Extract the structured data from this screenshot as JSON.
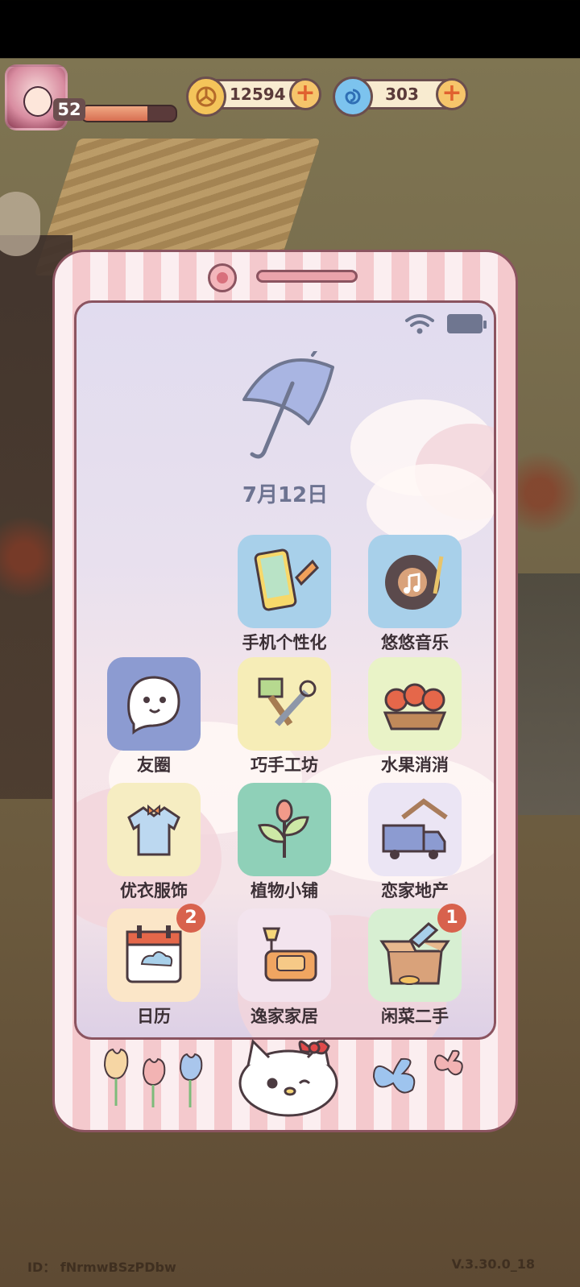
{
  "hud": {
    "level": "52",
    "xp_progress": 0.7,
    "gold": {
      "value": "12594",
      "icon": "gold-coin-icon"
    },
    "gems": {
      "value": "303",
      "icon": "swirl-gem-icon"
    }
  },
  "phone": {
    "status": {
      "wifi_icon": "wifi-icon",
      "battery_icon": "battery-icon"
    },
    "weather_icon": "umbrella-icon",
    "date": "7月12日",
    "apps": [
      {
        "label": "手机个性化",
        "icon": "phone-customize-icon",
        "badge": ""
      },
      {
        "label": "悠悠音乐",
        "icon": "music-record-icon",
        "badge": ""
      },
      {
        "label": "友圈",
        "icon": "ghost-chat-icon",
        "badge": ""
      },
      {
        "label": "巧手工坊",
        "icon": "tools-icon",
        "badge": ""
      },
      {
        "label": "水果消消",
        "icon": "fruit-basket-icon",
        "badge": ""
      },
      {
        "label": "优衣服饰",
        "icon": "shirt-icon",
        "badge": ""
      },
      {
        "label": "植物小铺",
        "icon": "plant-icon",
        "badge": ""
      },
      {
        "label": "恋家地产",
        "icon": "moving-truck-icon",
        "badge": ""
      },
      {
        "label": "日历",
        "icon": "calendar-icon",
        "badge": "2"
      },
      {
        "label": "逸家家居",
        "icon": "sofa-icon",
        "badge": ""
      },
      {
        "label": "闲菜二手",
        "icon": "box-icon",
        "badge": "1"
      }
    ]
  },
  "footer": {
    "id": "ID： fNrmwBSzPDbw",
    "version": "V.3.30.0_18"
  }
}
